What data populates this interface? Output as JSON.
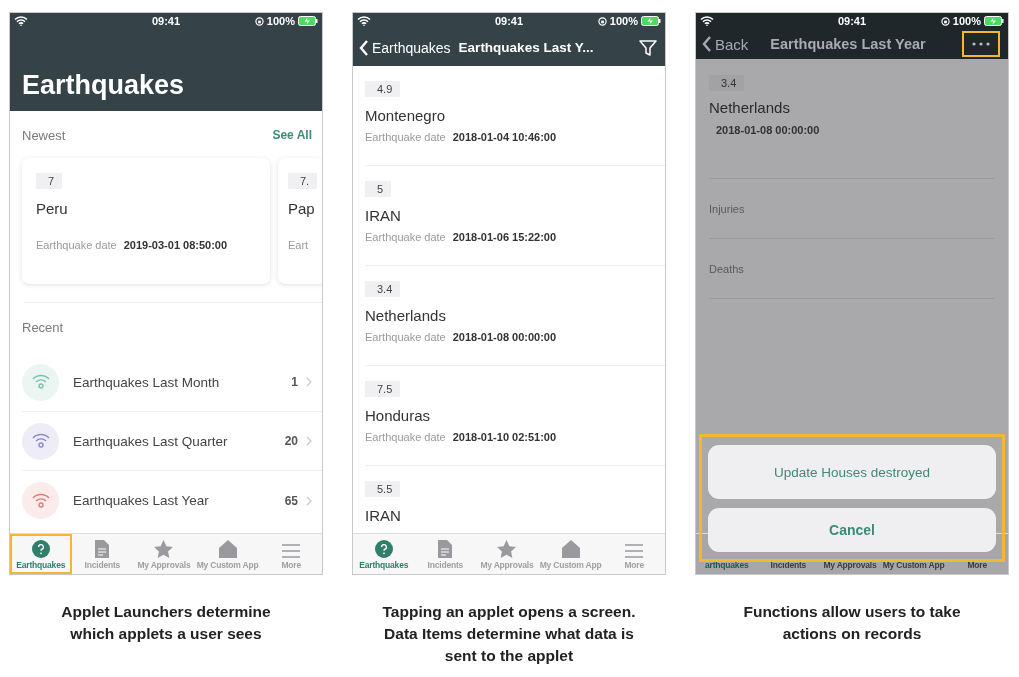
{
  "screens": [
    {
      "kind": "launcher",
      "status": {
        "time": "09:41",
        "battery": "100%"
      },
      "title": "Earthquakes",
      "newest": {
        "label": "Newest",
        "link": "See All",
        "cards": [
          {
            "magnitude": "7",
            "place": "Peru",
            "date_label": "Earthquake date",
            "date": "2019-03-01 08:50:00"
          },
          {
            "magnitude": "7.",
            "place": "Pap",
            "date_label": "Eart"
          }
        ]
      },
      "recent": {
        "label": "Recent",
        "items": [
          {
            "name": "Earthquakes Last Month",
            "count": "1",
            "color": "#7cc2ae"
          },
          {
            "name": "Earthquakes Last Quarter",
            "count": "20",
            "color": "#8c88c9"
          },
          {
            "name": "Earthquakes Last Year",
            "count": "65",
            "color": "#e27b7b"
          }
        ]
      },
      "tabs": [
        {
          "label": "Earthquakes",
          "selected": true,
          "highlighted": true
        },
        {
          "label": "Incidents",
          "selected": false,
          "highlighted": false
        },
        {
          "label": "My Approvals",
          "selected": false,
          "highlighted": false
        },
        {
          "label": "My Custom App",
          "selected": false,
          "highlighted": false
        },
        {
          "label": "More",
          "selected": false,
          "highlighted": false
        }
      ],
      "caption": "Applet Launchers determine\nwhich applets a user sees"
    },
    {
      "kind": "list",
      "status": {
        "time": "09:41",
        "battery": "100%"
      },
      "nav": {
        "back": "Earthquakes",
        "title": "Earthquakes Last Y..."
      },
      "records": [
        {
          "magnitude": "4.9",
          "place": "Montenegro",
          "date_label": "Earthquake date",
          "date": "2018-01-04 10:46:00"
        },
        {
          "magnitude": "5",
          "place": "IRAN",
          "date_label": "Earthquake date",
          "date": "2018-01-06 15:22:00"
        },
        {
          "magnitude": "3.4",
          "place": "Netherlands",
          "date_label": "Earthquake date",
          "date": "2018-01-08 00:00:00"
        },
        {
          "magnitude": "7.5",
          "place": "Honduras",
          "date_label": "Earthquake date",
          "date": "2018-01-10 02:51:00"
        },
        {
          "magnitude": "5.5",
          "place": "IRAN"
        }
      ],
      "tabs": [
        {
          "label": "Earthquakes",
          "selected": true,
          "highlighted": false
        },
        {
          "label": "Incidents",
          "selected": false,
          "highlighted": false
        },
        {
          "label": "My Approvals",
          "selected": false,
          "highlighted": false
        },
        {
          "label": "My Custom App",
          "selected": false,
          "highlighted": false
        },
        {
          "label": "More",
          "selected": false,
          "highlighted": false
        }
      ],
      "caption": "Tapping an applet opens a screen.\nData Items determine what data is\nsent to the applet"
    },
    {
      "kind": "detail",
      "status": {
        "time": "09:41",
        "battery": "100%"
      },
      "nav": {
        "back": "Back",
        "title": "Earthquakes Last Year",
        "more_highlighted": true
      },
      "record": {
        "magnitude": "3.4",
        "place": "Netherlands",
        "date": "2018-01-08 00:00:00"
      },
      "fields": [
        {
          "label": "Injuries"
        },
        {
          "label": "Deaths"
        }
      ],
      "actions": {
        "highlighted": true,
        "items": [
          {
            "label": "Update Houses destroyed",
            "kind": "action"
          },
          {
            "label": "Cancel",
            "kind": "cancel"
          }
        ]
      },
      "tabs": [
        {
          "label": "arthquakes",
          "selected": true,
          "highlighted": false
        },
        {
          "label": "Incidents",
          "selected": false,
          "highlighted": false
        },
        {
          "label": "My Approvals",
          "selected": false,
          "highlighted": false
        },
        {
          "label": "My Custom App",
          "selected": false,
          "highlighted": false
        },
        {
          "label": "More",
          "selected": false,
          "highlighted": false
        }
      ],
      "caption": "Functions allow users to take\nactions on records"
    }
  ]
}
